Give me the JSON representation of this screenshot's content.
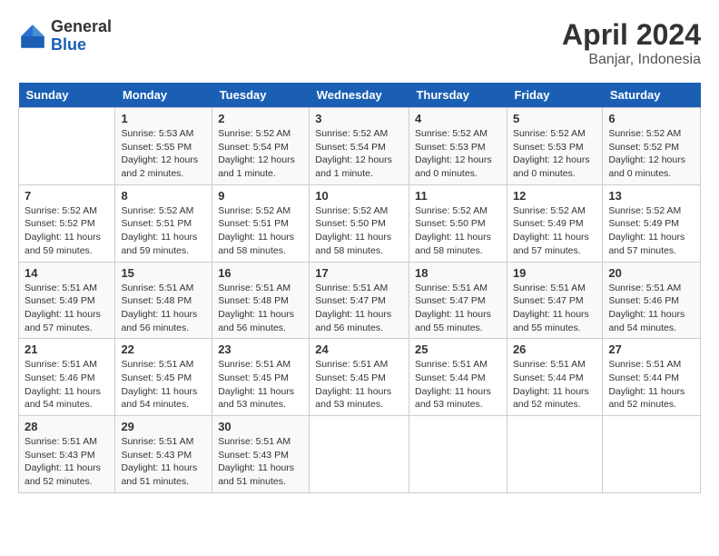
{
  "logo": {
    "general": "General",
    "blue": "Blue"
  },
  "title": "April 2024",
  "location": "Banjar, Indonesia",
  "days_of_week": [
    "Sunday",
    "Monday",
    "Tuesday",
    "Wednesday",
    "Thursday",
    "Friday",
    "Saturday"
  ],
  "weeks": [
    [
      {
        "num": "",
        "info": ""
      },
      {
        "num": "1",
        "info": "Sunrise: 5:53 AM\nSunset: 5:55 PM\nDaylight: 12 hours\nand 2 minutes."
      },
      {
        "num": "2",
        "info": "Sunrise: 5:52 AM\nSunset: 5:54 PM\nDaylight: 12 hours\nand 1 minute."
      },
      {
        "num": "3",
        "info": "Sunrise: 5:52 AM\nSunset: 5:54 PM\nDaylight: 12 hours\nand 1 minute."
      },
      {
        "num": "4",
        "info": "Sunrise: 5:52 AM\nSunset: 5:53 PM\nDaylight: 12 hours\nand 0 minutes."
      },
      {
        "num": "5",
        "info": "Sunrise: 5:52 AM\nSunset: 5:53 PM\nDaylight: 12 hours\nand 0 minutes."
      },
      {
        "num": "6",
        "info": "Sunrise: 5:52 AM\nSunset: 5:52 PM\nDaylight: 12 hours\nand 0 minutes."
      }
    ],
    [
      {
        "num": "7",
        "info": "Sunrise: 5:52 AM\nSunset: 5:52 PM\nDaylight: 11 hours\nand 59 minutes."
      },
      {
        "num": "8",
        "info": "Sunrise: 5:52 AM\nSunset: 5:51 PM\nDaylight: 11 hours\nand 59 minutes."
      },
      {
        "num": "9",
        "info": "Sunrise: 5:52 AM\nSunset: 5:51 PM\nDaylight: 11 hours\nand 58 minutes."
      },
      {
        "num": "10",
        "info": "Sunrise: 5:52 AM\nSunset: 5:50 PM\nDaylight: 11 hours\nand 58 minutes."
      },
      {
        "num": "11",
        "info": "Sunrise: 5:52 AM\nSunset: 5:50 PM\nDaylight: 11 hours\nand 58 minutes."
      },
      {
        "num": "12",
        "info": "Sunrise: 5:52 AM\nSunset: 5:49 PM\nDaylight: 11 hours\nand 57 minutes."
      },
      {
        "num": "13",
        "info": "Sunrise: 5:52 AM\nSunset: 5:49 PM\nDaylight: 11 hours\nand 57 minutes."
      }
    ],
    [
      {
        "num": "14",
        "info": "Sunrise: 5:51 AM\nSunset: 5:49 PM\nDaylight: 11 hours\nand 57 minutes."
      },
      {
        "num": "15",
        "info": "Sunrise: 5:51 AM\nSunset: 5:48 PM\nDaylight: 11 hours\nand 56 minutes."
      },
      {
        "num": "16",
        "info": "Sunrise: 5:51 AM\nSunset: 5:48 PM\nDaylight: 11 hours\nand 56 minutes."
      },
      {
        "num": "17",
        "info": "Sunrise: 5:51 AM\nSunset: 5:47 PM\nDaylight: 11 hours\nand 56 minutes."
      },
      {
        "num": "18",
        "info": "Sunrise: 5:51 AM\nSunset: 5:47 PM\nDaylight: 11 hours\nand 55 minutes."
      },
      {
        "num": "19",
        "info": "Sunrise: 5:51 AM\nSunset: 5:47 PM\nDaylight: 11 hours\nand 55 minutes."
      },
      {
        "num": "20",
        "info": "Sunrise: 5:51 AM\nSunset: 5:46 PM\nDaylight: 11 hours\nand 54 minutes."
      }
    ],
    [
      {
        "num": "21",
        "info": "Sunrise: 5:51 AM\nSunset: 5:46 PM\nDaylight: 11 hours\nand 54 minutes."
      },
      {
        "num": "22",
        "info": "Sunrise: 5:51 AM\nSunset: 5:45 PM\nDaylight: 11 hours\nand 54 minutes."
      },
      {
        "num": "23",
        "info": "Sunrise: 5:51 AM\nSunset: 5:45 PM\nDaylight: 11 hours\nand 53 minutes."
      },
      {
        "num": "24",
        "info": "Sunrise: 5:51 AM\nSunset: 5:45 PM\nDaylight: 11 hours\nand 53 minutes."
      },
      {
        "num": "25",
        "info": "Sunrise: 5:51 AM\nSunset: 5:44 PM\nDaylight: 11 hours\nand 53 minutes."
      },
      {
        "num": "26",
        "info": "Sunrise: 5:51 AM\nSunset: 5:44 PM\nDaylight: 11 hours\nand 52 minutes."
      },
      {
        "num": "27",
        "info": "Sunrise: 5:51 AM\nSunset: 5:44 PM\nDaylight: 11 hours\nand 52 minutes."
      }
    ],
    [
      {
        "num": "28",
        "info": "Sunrise: 5:51 AM\nSunset: 5:43 PM\nDaylight: 11 hours\nand 52 minutes."
      },
      {
        "num": "29",
        "info": "Sunrise: 5:51 AM\nSunset: 5:43 PM\nDaylight: 11 hours\nand 51 minutes."
      },
      {
        "num": "30",
        "info": "Sunrise: 5:51 AM\nSunset: 5:43 PM\nDaylight: 11 hours\nand 51 minutes."
      },
      {
        "num": "",
        "info": ""
      },
      {
        "num": "",
        "info": ""
      },
      {
        "num": "",
        "info": ""
      },
      {
        "num": "",
        "info": ""
      }
    ]
  ]
}
